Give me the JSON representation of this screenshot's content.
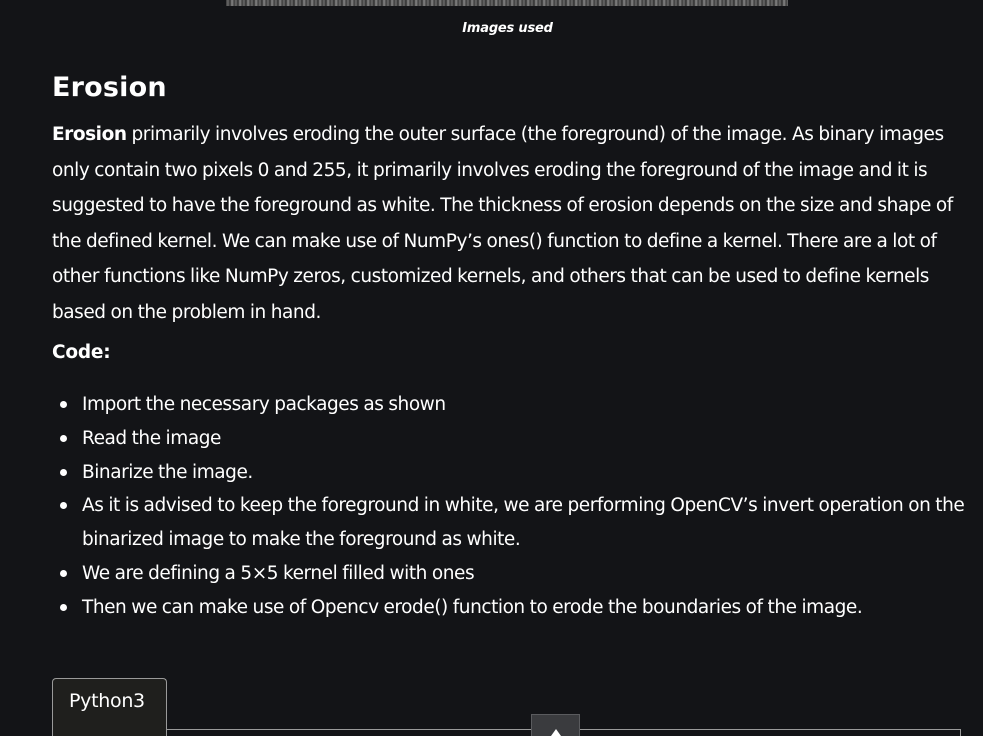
{
  "figure": {
    "caption": "Images used"
  },
  "section": {
    "heading": "Erosion",
    "intro_bold": "Erosion",
    "intro_rest": " primarily involves eroding the outer surface (the foreground) of the image. As binary images only contain two pixels 0 and 255, it primarily involves eroding the foreground of the image and it is suggested to have the foreground as white. The thickness of erosion depends on the size and shape of the defined kernel. We can make use of NumPy’s ones() function to define a kernel. There are a lot of other functions like NumPy zeros, customized kernels, and others that can be used to define kernels based on the problem in hand.",
    "code_label": "Code:",
    "steps": [
      "Import the necessary packages as shown",
      "Read the image",
      "Binarize the image.",
      "As it is advised to keep the foreground in white, we are performing OpenCV’s invert operation on the binarized image to make the foreground as white.",
      "We are defining a 5×5 kernel filled with ones",
      "Then we can make use of Opencv erode() function to erode the boundaries of the image."
    ]
  },
  "code_block": {
    "tab_label": "Python3",
    "scroll_icon": "chevron-up-icon"
  }
}
